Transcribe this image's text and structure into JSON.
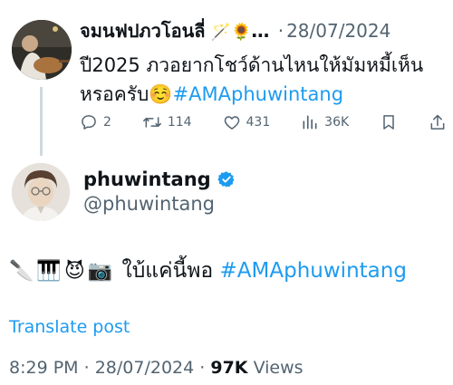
{
  "parent_tweet": {
    "author_name": "จมนฟปภวโอนลี่",
    "name_emoji": "🪄🌻",
    "name_ellipsis": "…",
    "separator": "·",
    "date": "28/07/2024",
    "text_line1": "ปี2025 ภวอยากโชว์ด้านไหนให้มัมหมี้เห็น",
    "text_line2": "หรอครับ",
    "text_emoji": "☺️",
    "hashtag": "#AMAphuwintang",
    "actions": {
      "reply_icon": "reply-icon",
      "reply_count": "2",
      "retweet_icon": "retweet-icon",
      "retweet_count": "114",
      "like_icon": "heart-icon",
      "like_count": "431",
      "views_icon": "analytics-icon",
      "views_count": "36K",
      "bookmark_icon": "bookmark-icon",
      "share_icon": "share-icon"
    }
  },
  "main_tweet": {
    "author_name": "phuwintang",
    "verified_icon": "verified-badge-icon",
    "handle": "@phuwintang",
    "emojis": [
      "🔪",
      "🎹",
      "😈",
      "📷"
    ],
    "text": "ใบ้แค่นี้พอ",
    "hashtag": "#AMAphuwintang",
    "translate_label": "Translate post",
    "time": "8:29 PM",
    "separator": "·",
    "date": "28/07/2024",
    "views_count": "97K",
    "views_label": "Views"
  },
  "colors": {
    "accent": "#1d9bf0",
    "secondary_text": "#536471",
    "primary_text": "#0f1419",
    "thread_line": "#cfd9de"
  }
}
